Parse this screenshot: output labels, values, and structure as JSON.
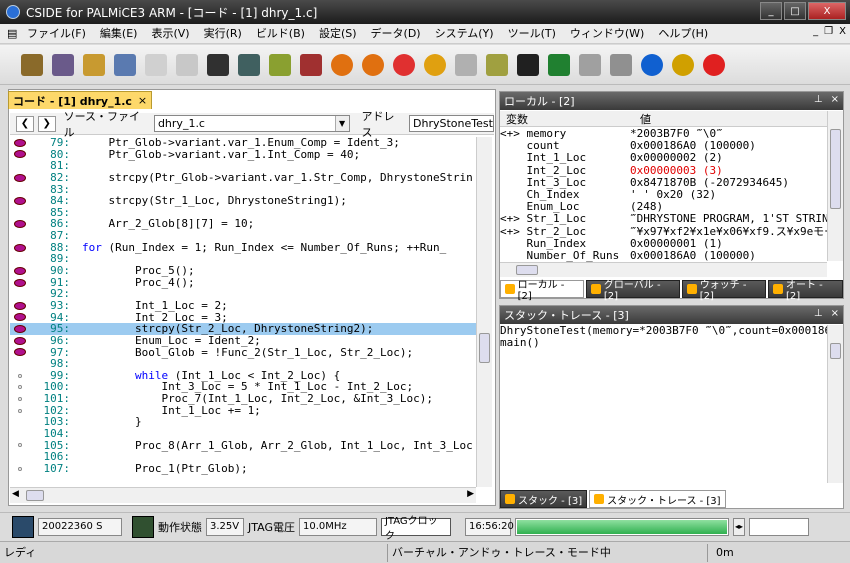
{
  "window": {
    "title": "CSIDE for PALMiCE3 ARM - [コード - [1] dhry_1.c]",
    "min": "_",
    "max": "□",
    "close": "X"
  },
  "menu": [
    "ファイル(F)",
    "編集(E)",
    "表示(V)",
    "実行(R)",
    "ビルド(B)",
    "設定(S)",
    "データ(D)",
    "システム(Y)",
    "ツール(T)",
    "ウィンドウ(W)",
    "ヘルプ(H)"
  ],
  "mdi_controls": {
    "min": "_",
    "restore": "❐",
    "close": "X"
  },
  "toolbar": [
    {
      "icon": "open-folder-icon",
      "color": "#8a6a2a"
    },
    {
      "icon": "open-project-icon",
      "color": "#6a5a8a"
    },
    {
      "icon": "folder-icon",
      "color": "#c89a30"
    },
    {
      "icon": "file-list-icon",
      "color": "#5a7ab0"
    },
    {
      "icon": "memory-icon",
      "color": "#d0d0d0"
    },
    {
      "icon": "register-icon",
      "color": "#c8c8c8"
    },
    {
      "icon": "disassembly-icon",
      "color": "#303030"
    },
    {
      "icon": "watch-icon",
      "color": "#406060"
    },
    {
      "icon": "build-icon",
      "color": "#8aa030"
    },
    {
      "icon": "rebuild-icon",
      "color": "#a03030"
    },
    {
      "icon": "go-icon",
      "color": "#e07010"
    },
    {
      "icon": "step-icon",
      "color": "#e07010"
    },
    {
      "icon": "step-over-icon",
      "color": "#e03030"
    },
    {
      "icon": "step-out-icon",
      "color": "#e0a010"
    },
    {
      "icon": "break-icon",
      "color": "#b0b0b0"
    },
    {
      "icon": "trace-icon",
      "color": "#a0a040"
    },
    {
      "icon": "camera-icon",
      "color": "#202020"
    },
    {
      "icon": "board-icon",
      "color": "#208030"
    },
    {
      "icon": "probe-icon",
      "color": "#a0a0a0"
    },
    {
      "icon": "jtag-icon",
      "color": "#909090"
    },
    {
      "icon": "reset-icon",
      "color": "#1060d0"
    },
    {
      "icon": "stop-icon",
      "color": "#d0a000"
    },
    {
      "icon": "record-icon",
      "color": "#e02020"
    }
  ],
  "code": {
    "tab_label": "コード - [1] dhry_1.c",
    "tab_close": "×",
    "source_label": "ソース・ファイル",
    "source_value": "dhry_1.c",
    "address_label": "アドレス",
    "address_value": "DhryStoneTest+8",
    "lines": [
      {
        "n": "79:",
        "bp": "full",
        "text": "    Ptr_Glob->variant.var_1.Enum_Comp = Ident_3;"
      },
      {
        "n": "80:",
        "bp": "full",
        "text": "    Ptr_Glob->variant.var_1.Int_Comp = 40;"
      },
      {
        "n": "81:",
        "bp": "empty",
        "text": ""
      },
      {
        "n": "82:",
        "bp": "full",
        "text": "    strcpy(Ptr_Glob->variant.var_1.Str_Comp, DhrystoneStrin"
      },
      {
        "n": "83:",
        "bp": "empty",
        "text": ""
      },
      {
        "n": "84:",
        "bp": "full",
        "text": "    strcpy(Str_1_Loc, DhrystoneString1);"
      },
      {
        "n": "85:",
        "bp": "empty",
        "text": ""
      },
      {
        "n": "86:",
        "bp": "full",
        "text": "    Arr_2_Glob[8][7] = 10;"
      },
      {
        "n": "87:",
        "bp": "empty",
        "text": ""
      },
      {
        "n": "88:",
        "bp": "full",
        "kw": "for",
        "text": " (Run_Index = 1; Run_Index <= Number_Of_Runs; ++Run_"
      },
      {
        "n": "89:",
        "bp": "empty",
        "text": ""
      },
      {
        "n": "90:",
        "bp": "full",
        "text": "        Proc_5();"
      },
      {
        "n": "91:",
        "bp": "full",
        "text": "        Proc_4();"
      },
      {
        "n": "92:",
        "bp": "empty",
        "text": ""
      },
      {
        "n": "93:",
        "bp": "full",
        "text": "        Int_1_Loc = 2;"
      },
      {
        "n": "94:",
        "bp": "full",
        "text": "        Int_2_Loc = 3;"
      },
      {
        "n": "95:",
        "bp": "full",
        "hl": true,
        "text": "        strcpy(Str_2_Loc, DhrystoneString2);"
      },
      {
        "n": "96:",
        "bp": "full",
        "text": "        Enum_Loc = Ident_2;"
      },
      {
        "n": "97:",
        "bp": "full",
        "text": "        Bool_Glob = !Func_2(Str_1_Loc, Str_2_Loc);"
      },
      {
        "n": "98:",
        "bp": "empty",
        "text": ""
      },
      {
        "n": "99:",
        "bp": "dot",
        "kw": "        while",
        "text": " (Int_1_Loc < Int_2_Loc) {"
      },
      {
        "n": "100:",
        "bp": "dot",
        "text": "            Int_3_Loc = 5 * Int_1_Loc - Int_2_Loc;"
      },
      {
        "n": "101:",
        "bp": "dot",
        "text": "            Proc_7(Int_1_Loc, Int_2_Loc, &Int_3_Loc);"
      },
      {
        "n": "102:",
        "bp": "dot",
        "text": "            Int_1_Loc += 1;"
      },
      {
        "n": "103:",
        "bp": "empty",
        "text": "        }"
      },
      {
        "n": "104:",
        "bp": "empty",
        "text": ""
      },
      {
        "n": "105:",
        "bp": "dot",
        "text": "        Proc_8(Arr_1_Glob, Arr_2_Glob, Int_1_Loc, Int_3_Loc"
      },
      {
        "n": "106:",
        "bp": "empty",
        "text": ""
      },
      {
        "n": "107:",
        "bp": "dot",
        "text": "        Proc_1(Ptr_Glob);"
      }
    ]
  },
  "local": {
    "title": "ローカル - [2]",
    "pin": "⊥",
    "close": "×",
    "col_var": "変数",
    "col_val": "値",
    "rows": [
      {
        "name": "<+> memory",
        "value": "*2003B7F0 ‴\\0‴"
      },
      {
        "name": "    count",
        "value": "0x000186A0 (100000)"
      },
      {
        "name": "    Int_1_Loc",
        "value": "0x00000002 (2)"
      },
      {
        "name": "    Int_2_Loc",
        "value": "0x00000003 (3)",
        "changed": true
      },
      {
        "name": "    Int_3_Loc",
        "value": "0x8471870B (-2072934645)"
      },
      {
        "name": "    Ch_Index",
        "value": "' ' 0x20 (32)"
      },
      {
        "name": "    Enum_Loc",
        "value": "(248)"
      },
      {
        "name": "<+> Str_1_Loc",
        "value": "‴DHRYSTONE PROGRAM, 1'ST STRIN"
      },
      {
        "name": "<+> Str_2_Loc",
        "value": "‴¥x97¥xf2¥x1e¥x06¥xf9.ス¥x9eモー"
      },
      {
        "name": "    Run_Index",
        "value": "0x00000001 (1)"
      },
      {
        "name": "    Number_Of_Runs",
        "value": "0x000186A0 (100000)"
      }
    ],
    "tabs": [
      {
        "label": "ローカル - [2]",
        "active": true
      },
      {
        "label": "グローバル - [2]"
      },
      {
        "label": "ウォッチ - [2]"
      },
      {
        "label": "オート - [2]"
      }
    ]
  },
  "stack": {
    "title": "スタック・トレース - [3]",
    "pin": "⊥",
    "close": "×",
    "lines": [
      "DhryStoneTest(memory=*2003B7F0 ‴\\0‴,count=0x000186",
      "main()"
    ],
    "tabs": [
      {
        "label": "スタック - [3]"
      },
      {
        "label": "スタック・トレース - [3]",
        "active": true
      }
    ]
  },
  "statusbar": {
    "clock": "20022360 S",
    "state_label": "動作状態",
    "voltage": "3.25V",
    "jtag_voltage_label": "JTAG電圧",
    "freq": "10.0MHz",
    "jtag_clock_button": "JTAGクロック",
    "time": "16:56:20",
    "progress": 1.0
  },
  "status2": {
    "ready": "レディ",
    "mode": "バーチャル・アンドゥ・トレース・モード中",
    "time": "0m"
  }
}
